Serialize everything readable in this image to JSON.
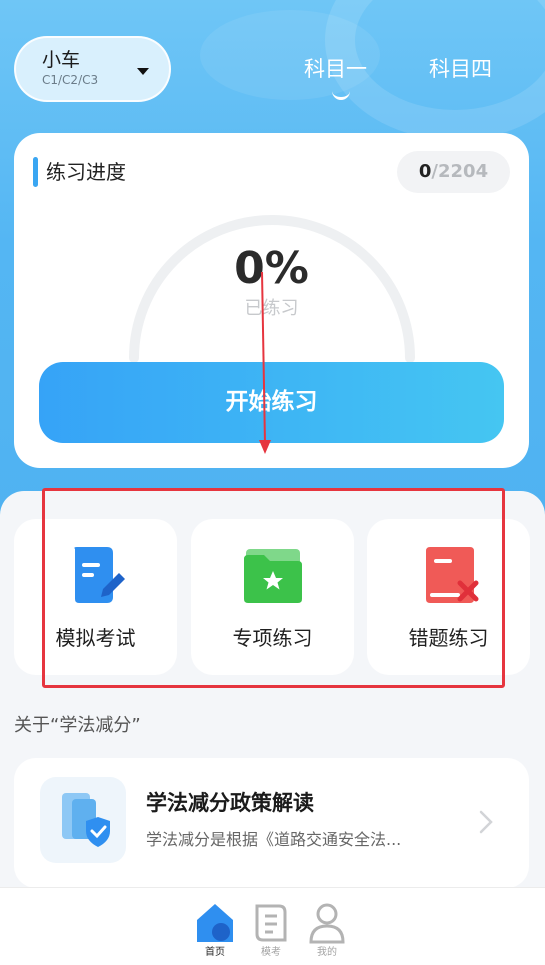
{
  "header": {
    "license": {
      "title": "小车",
      "subtitle": "C1/C2/C3"
    },
    "subject_tabs": [
      {
        "label": "科目一",
        "active": true
      },
      {
        "label": "科目四",
        "active": false
      }
    ]
  },
  "progress_card": {
    "title": "练习进度",
    "done": "0",
    "separator": "/",
    "total": "2204",
    "percent": "0%",
    "percent_value": 0,
    "percent_label": "已练习",
    "start_button": "开始练习"
  },
  "features": [
    {
      "label": "模拟考试",
      "icon": "exam-paper-icon",
      "color": "#2f8ff0"
    },
    {
      "label": "专项练习",
      "icon": "star-folder-icon",
      "color": "#3cc24a"
    },
    {
      "label": "错题练习",
      "icon": "wrong-book-icon",
      "color": "#f05a57"
    }
  ],
  "section": {
    "heading": "关于“学法减分”"
  },
  "article": {
    "title": "学法减分政策解读",
    "description": "学法减分是根据《道路交通安全法..."
  },
  "bottom_nav": [
    {
      "label": "首页",
      "icon": "home-icon",
      "active": true
    },
    {
      "label": "模考",
      "icon": "exam-icon",
      "active": false
    },
    {
      "label": "我的",
      "icon": "profile-icon",
      "active": false
    }
  ],
  "colors": {
    "accent": "#3aa6f2",
    "annotation": "#e6353f"
  }
}
